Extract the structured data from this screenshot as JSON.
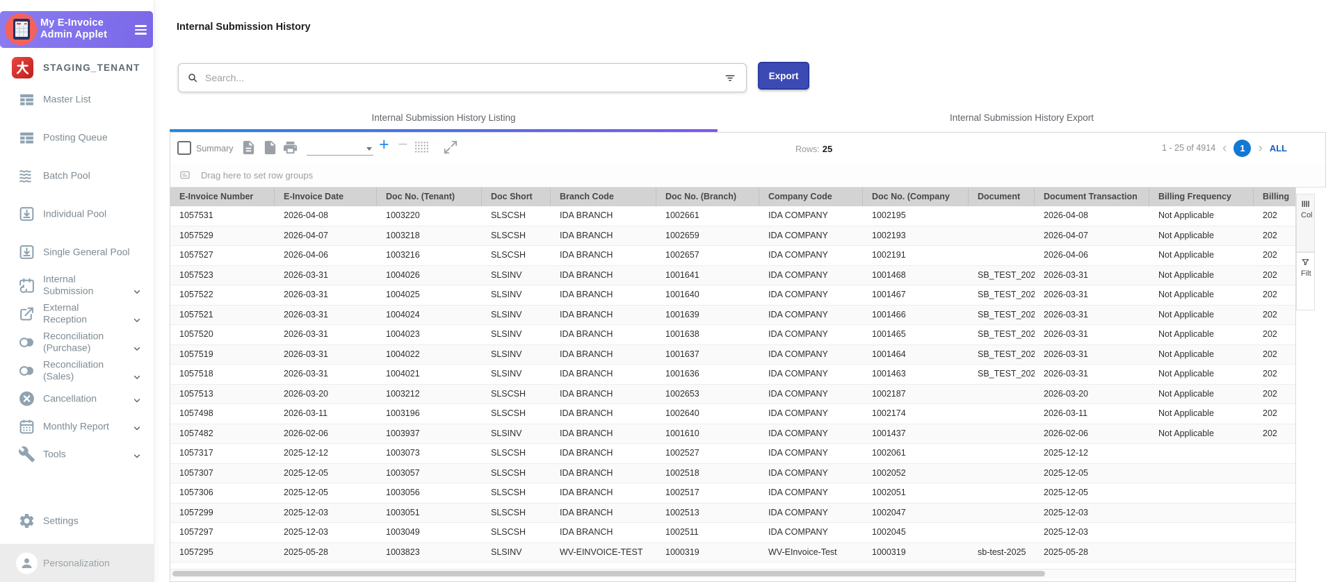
{
  "app": {
    "title_line1": "My E-Invoice",
    "title_line2": "Admin Applet",
    "tenant": "STAGING_TENANT"
  },
  "sidebar": {
    "items": [
      {
        "label": "Master List",
        "icon": "table-icon",
        "chevron": false
      },
      {
        "label": "Posting Queue",
        "icon": "table-icon",
        "chevron": false
      },
      {
        "label": "Batch Pool",
        "icon": "waves-icon",
        "chevron": false
      },
      {
        "label": "Individual Pool",
        "icon": "download-box-icon",
        "chevron": false
      },
      {
        "label": "Single General Pool",
        "icon": "download-box-icon",
        "chevron": false
      },
      {
        "label": "Internal Submission",
        "lines": [
          "Internal",
          "Submission"
        ],
        "icon": "calendar-history-icon",
        "chevron": true
      },
      {
        "label": "External Reception",
        "lines": [
          "External",
          "Reception"
        ],
        "icon": "external-link-icon",
        "chevron": true
      },
      {
        "label": "Reconciliation (Purchase)",
        "lines": [
          "Reconciliation",
          "(Purchase)"
        ],
        "icon": "compare-circles-icon",
        "chevron": true
      },
      {
        "label": "Reconciliation (Sales)",
        "lines": [
          "Reconciliation",
          "(Sales)"
        ],
        "icon": "compare-circles-icon",
        "chevron": true
      },
      {
        "label": "Cancellation",
        "icon": "cancel-circle-icon",
        "chevron": true
      },
      {
        "label": "Monthly Report",
        "icon": "calendar-icon",
        "chevron": true
      },
      {
        "label": "Tools",
        "icon": "wrench-icon",
        "chevron": true
      }
    ],
    "settings_label": "Settings",
    "personalization_label": "Personalization"
  },
  "page": {
    "title": "Internal Submission History"
  },
  "search": {
    "placeholder": "Search..."
  },
  "actions": {
    "export_label": "Export"
  },
  "tabs": [
    {
      "label": "Internal Submission History Listing",
      "active": true
    },
    {
      "label": "Internal Submission History Export",
      "active": false
    }
  ],
  "toolbar": {
    "summary_label": "Summary",
    "rows_label": "Rows:",
    "rows_value": "25"
  },
  "pagination": {
    "range_text": "1 - 25 of 4914",
    "current_page": "1",
    "all_label": "ALL"
  },
  "group_bar": {
    "text": "Drag here to set row groups"
  },
  "side_panel": {
    "columns_label": "Col",
    "filters_label": "Filt"
  },
  "table": {
    "columns": [
      "E-Invoice Number",
      "E-Invoice Date",
      "Doc No. (Tenant)",
      "Doc Short",
      "Branch Code",
      "Doc No. (Branch)",
      "Company Code",
      "Doc No. (Company",
      "Document",
      "Document Transaction",
      "Billing Frequency",
      "Billing"
    ],
    "rows": [
      [
        "1057531",
        "2026-04-08",
        "1003220",
        "SLSCSH",
        "IDA BRANCH",
        "1002661",
        "IDA COMPANY",
        "1002195",
        "",
        "2026-04-08",
        "Not Applicable",
        "202"
      ],
      [
        "1057529",
        "2026-04-07",
        "1003218",
        "SLSCSH",
        "IDA BRANCH",
        "1002659",
        "IDA COMPANY",
        "1002193",
        "",
        "2026-04-07",
        "Not Applicable",
        "202"
      ],
      [
        "1057527",
        "2026-04-06",
        "1003216",
        "SLSCSH",
        "IDA BRANCH",
        "1002657",
        "IDA COMPANY",
        "1002191",
        "",
        "2026-04-06",
        "Not Applicable",
        "202"
      ],
      [
        "1057523",
        "2026-03-31",
        "1004026",
        "SLSINV",
        "IDA BRANCH",
        "1001641",
        "IDA COMPANY",
        "1001468",
        "SB_TEST_202",
        "2026-03-31",
        "Not Applicable",
        "202"
      ],
      [
        "1057522",
        "2026-03-31",
        "1004025",
        "SLSINV",
        "IDA BRANCH",
        "1001640",
        "IDA COMPANY",
        "1001467",
        "SB_TEST_202",
        "2026-03-31",
        "Not Applicable",
        "202"
      ],
      [
        "1057521",
        "2026-03-31",
        "1004024",
        "SLSINV",
        "IDA BRANCH",
        "1001639",
        "IDA COMPANY",
        "1001466",
        "SB_TEST_202",
        "2026-03-31",
        "Not Applicable",
        "202"
      ],
      [
        "1057520",
        "2026-03-31",
        "1004023",
        "SLSINV",
        "IDA BRANCH",
        "1001638",
        "IDA COMPANY",
        "1001465",
        "SB_TEST_202",
        "2026-03-31",
        "Not Applicable",
        "202"
      ],
      [
        "1057519",
        "2026-03-31",
        "1004022",
        "SLSINV",
        "IDA BRANCH",
        "1001637",
        "IDA COMPANY",
        "1001464",
        "SB_TEST_202",
        "2026-03-31",
        "Not Applicable",
        "202"
      ],
      [
        "1057518",
        "2026-03-31",
        "1004021",
        "SLSINV",
        "IDA BRANCH",
        "1001636",
        "IDA COMPANY",
        "1001463",
        "SB_TEST_202",
        "2026-03-31",
        "Not Applicable",
        "202"
      ],
      [
        "1057513",
        "2026-03-20",
        "1003212",
        "SLSCSH",
        "IDA BRANCH",
        "1002653",
        "IDA COMPANY",
        "1002187",
        "",
        "2026-03-20",
        "Not Applicable",
        "202"
      ],
      [
        "1057498",
        "2026-03-11",
        "1003196",
        "SLSCSH",
        "IDA BRANCH",
        "1002640",
        "IDA COMPANY",
        "1002174",
        "",
        "2026-03-11",
        "Not Applicable",
        "202"
      ],
      [
        "1057482",
        "2026-02-06",
        "1003937",
        "SLSINV",
        "IDA BRANCH",
        "1001610",
        "IDA COMPANY",
        "1001437",
        "",
        "2026-02-06",
        "Not Applicable",
        "202"
      ],
      [
        "1057317",
        "2025-12-12",
        "1003073",
        "SLSCSH",
        "IDA BRANCH",
        "1002527",
        "IDA COMPANY",
        "1002061",
        "",
        "2025-12-12",
        "",
        ""
      ],
      [
        "1057307",
        "2025-12-05",
        "1003057",
        "SLSCSH",
        "IDA BRANCH",
        "1002518",
        "IDA COMPANY",
        "1002052",
        "",
        "2025-12-05",
        "",
        ""
      ],
      [
        "1057306",
        "2025-12-05",
        "1003056",
        "SLSCSH",
        "IDA BRANCH",
        "1002517",
        "IDA COMPANY",
        "1002051",
        "",
        "2025-12-05",
        "",
        ""
      ],
      [
        "1057299",
        "2025-12-03",
        "1003051",
        "SLSCSH",
        "IDA BRANCH",
        "1002513",
        "IDA COMPANY",
        "1002047",
        "",
        "2025-12-03",
        "",
        ""
      ],
      [
        "1057297",
        "2025-12-03",
        "1003049",
        "SLSCSH",
        "IDA BRANCH",
        "1002511",
        "IDA COMPANY",
        "1002045",
        "",
        "2025-12-03",
        "",
        ""
      ],
      [
        "1057295",
        "2025-05-28",
        "1003823",
        "SLSINV",
        "WV-EINVOICE-TEST",
        "1000319",
        "WV-EInvoice-Test",
        "1000319",
        "sb-test-2025",
        "2025-05-28",
        "",
        ""
      ]
    ]
  },
  "colors": {
    "sidebar_header_purple": "#7d6cea",
    "export_button_blue": "#3c4bb4",
    "tab_gradient_start": "#1e88e5",
    "tab_gradient_end": "#7e57f0",
    "pagination_active_blue": "#1278d4",
    "all_link_blue": "#1460c0",
    "grid_header_gray": "#d3d3d3"
  }
}
